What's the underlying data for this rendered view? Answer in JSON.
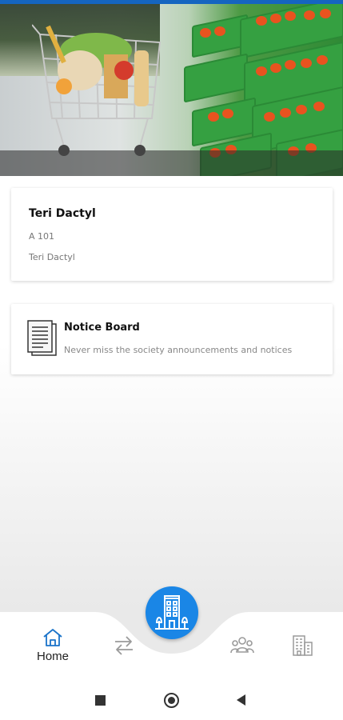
{
  "banner": {
    "image": "grocery-cart-produce-shelves"
  },
  "profile": {
    "name": "Teri Dactyl",
    "unit": "A 101",
    "owner": "Teri Dactyl"
  },
  "notice_board": {
    "title": "Notice Board",
    "subtitle": "Never miss the society announcements and notices",
    "icon": "document-icon"
  },
  "bottom_nav": {
    "items": [
      {
        "label": "Home",
        "icon": "home-icon",
        "active": true
      },
      {
        "label": "",
        "icon": "swap-arrows-icon"
      },
      {
        "label": "",
        "icon": "building-fab-icon"
      },
      {
        "label": "",
        "icon": "community-people-icon"
      },
      {
        "label": "",
        "icon": "apartment-building-icon"
      }
    ]
  },
  "colors": {
    "accent": "#1a86e6",
    "top_bar": "#1565c0",
    "home_active": "#1a73c9"
  },
  "system_nav": {
    "buttons": [
      "recents",
      "home",
      "back"
    ]
  }
}
